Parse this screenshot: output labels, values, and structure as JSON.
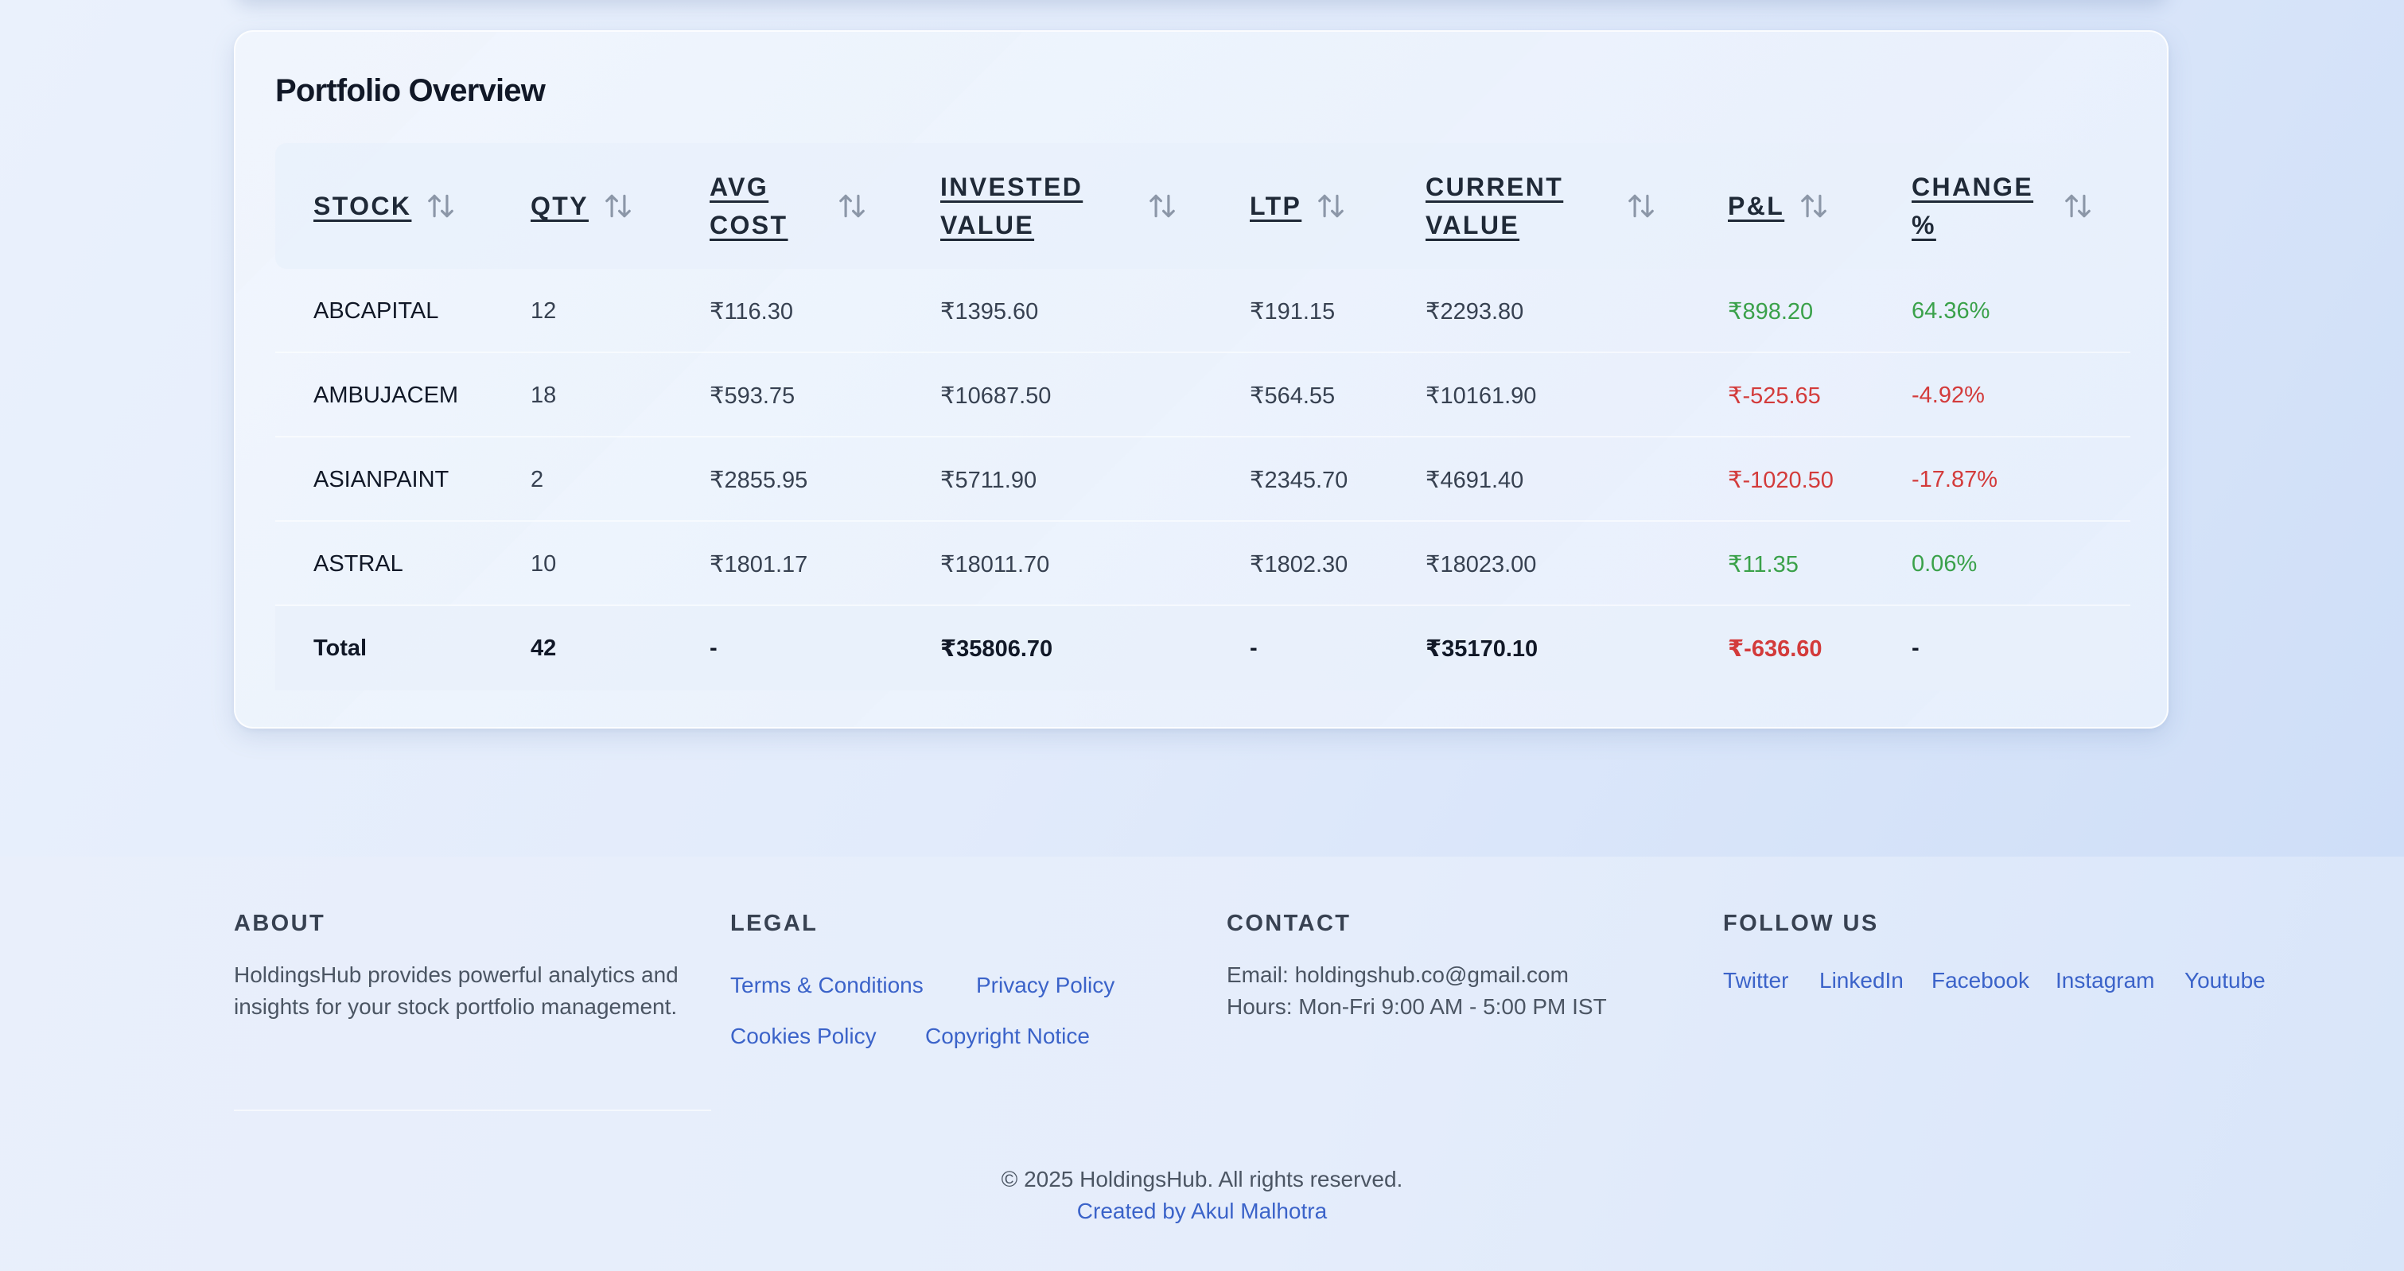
{
  "portfolio": {
    "title": "Portfolio Overview",
    "columns": [
      {
        "label": "STOCK",
        "two_line": false
      },
      {
        "label": "QTY",
        "two_line": false
      },
      {
        "label": "AVG COST",
        "two_line": true
      },
      {
        "label": "INVESTED VALUE",
        "two_line": true
      },
      {
        "label": "LTP",
        "two_line": false
      },
      {
        "label": "CURRENT VALUE",
        "two_line": true
      },
      {
        "label": "P&L",
        "two_line": false
      },
      {
        "label": "CHANGE %",
        "two_line": true
      }
    ],
    "rows": [
      {
        "stock": "ABCAPITAL",
        "qty": "12",
        "avg_cost": "₹116.30",
        "invested": "₹1395.60",
        "ltp": "₹191.15",
        "current": "₹2293.80",
        "pnl": "₹898.20",
        "change": "64.36%",
        "trend": "gain"
      },
      {
        "stock": "AMBUJACEM",
        "qty": "18",
        "avg_cost": "₹593.75",
        "invested": "₹10687.50",
        "ltp": "₹564.55",
        "current": "₹10161.90",
        "pnl": "₹-525.65",
        "change": "-4.92%",
        "trend": "loss"
      },
      {
        "stock": "ASIANPAINT",
        "qty": "2",
        "avg_cost": "₹2855.95",
        "invested": "₹5711.90",
        "ltp": "₹2345.70",
        "current": "₹4691.40",
        "pnl": "₹-1020.50",
        "change": "-17.87%",
        "trend": "loss"
      },
      {
        "stock": "ASTRAL",
        "qty": "10",
        "avg_cost": "₹1801.17",
        "invested": "₹18011.70",
        "ltp": "₹1802.30",
        "current": "₹18023.00",
        "pnl": "₹11.35",
        "change": "0.06%",
        "trend": "gain"
      }
    ],
    "total": {
      "stock": "Total",
      "qty": "42",
      "avg_cost": "-",
      "invested": "₹35806.70",
      "ltp": "-",
      "current": "₹35170.10",
      "pnl": "₹-636.60",
      "change": "-",
      "trend": "loss"
    },
    "colors": {
      "gain": "#3aa14a",
      "loss": "#d33b3b",
      "link": "#3b63c9"
    }
  },
  "footer": {
    "about": {
      "heading": "ABOUT",
      "text": "HoldingsHub provides powerful analytics and insights for your stock portfolio management."
    },
    "legal": {
      "heading": "LEGAL",
      "links": [
        "Terms & Conditions",
        "Privacy Policy",
        "Cookies Policy",
        "Copyright Notice"
      ]
    },
    "contact": {
      "heading": "CONTACT",
      "email": "Email: holdingshub.co@gmail.com",
      "hours": "Hours: Mon-Fri 9:00 AM - 5:00 PM IST"
    },
    "follow": {
      "heading": "FOLLOW US",
      "links": [
        "Twitter",
        "LinkedIn",
        "Facebook",
        "Instagram",
        "Youtube"
      ]
    },
    "copyright": "© 2025 HoldingsHub. All rights reserved.",
    "credit": "Created by Akul Malhotra"
  }
}
